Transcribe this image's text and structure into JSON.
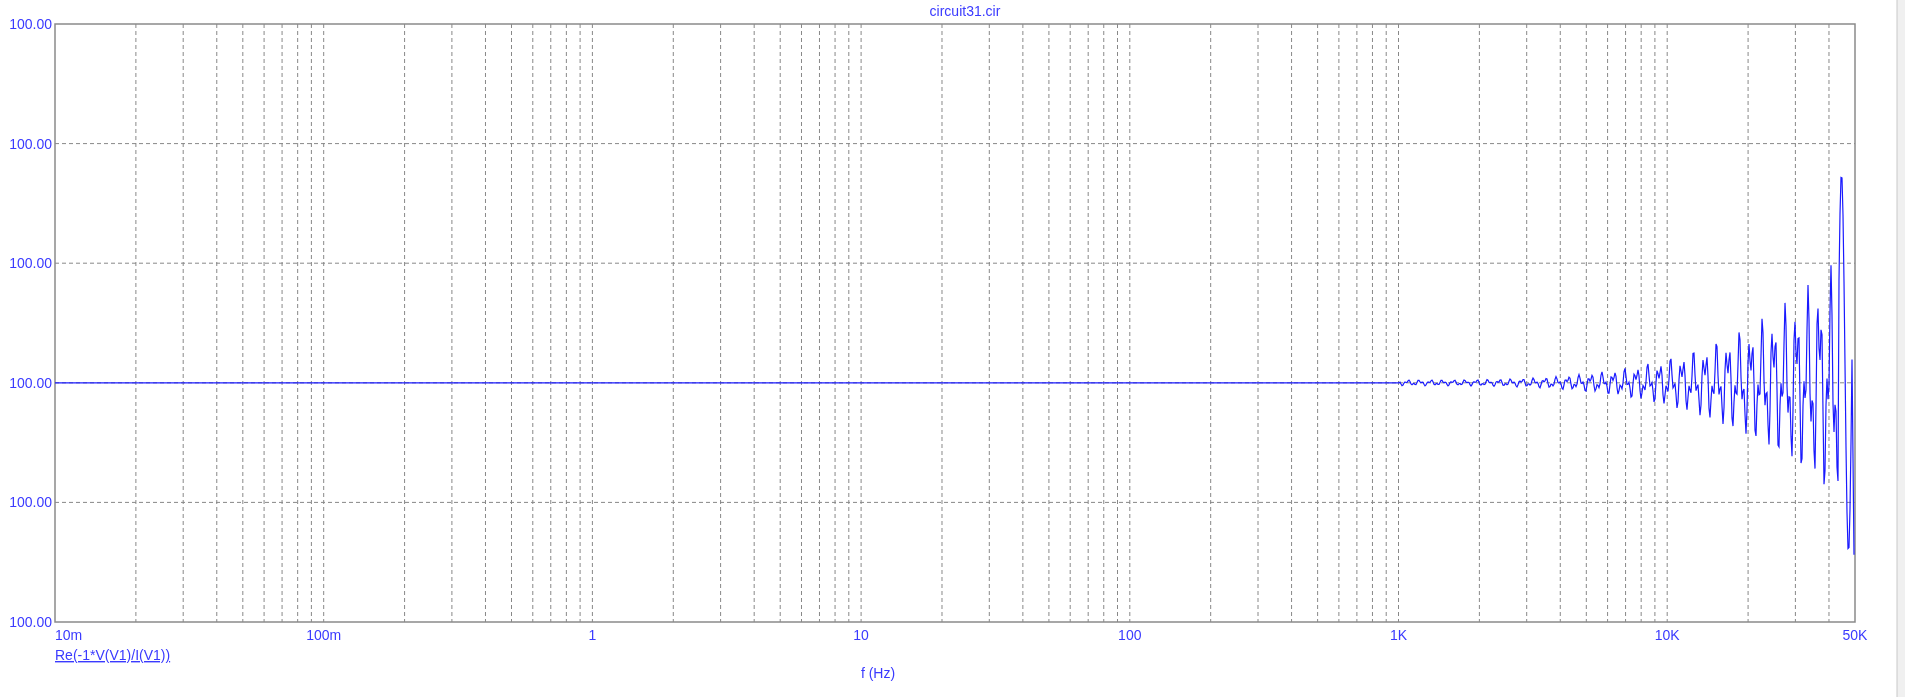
{
  "title": "circuit31.cir",
  "y_labels": [
    "100.00",
    "100.00",
    "100.00",
    "100.00",
    "100.00",
    "100.00"
  ],
  "x_labels": [
    "10m",
    "100m",
    "1",
    "10",
    "100",
    "1K",
    "10K",
    "50K"
  ],
  "legend": "Re(-1*V(V1)/I(V1))",
  "xlabel": "f (Hz)"
}
